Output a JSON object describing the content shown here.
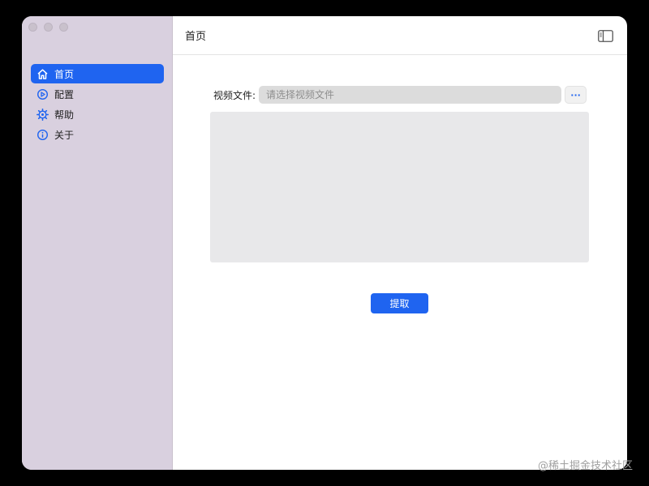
{
  "sidebar": {
    "items": [
      {
        "label": "首页",
        "icon": "home-icon",
        "active": true
      },
      {
        "label": "配置",
        "icon": "settings-icon",
        "active": false
      },
      {
        "label": "帮助",
        "icon": "help-gear-icon",
        "active": false
      },
      {
        "label": "关于",
        "icon": "info-icon",
        "active": false
      }
    ]
  },
  "header": {
    "title": "首页",
    "toggle_icon": "sidebar-toggle-icon"
  },
  "form": {
    "file_label": "视频文件:",
    "file_placeholder": "请选择视频文件",
    "file_value": "",
    "browse_label": "···",
    "output_text": ""
  },
  "actions": {
    "extract_label": "提取"
  },
  "watermark": "@稀土掘金技术社区",
  "colors": {
    "accent": "#1f64f0",
    "sidebar_bg": "#d9d0df",
    "window_bg": "#ffffff",
    "input_bg": "#dcdcdc",
    "textarea_bg": "#e8e8ea"
  }
}
